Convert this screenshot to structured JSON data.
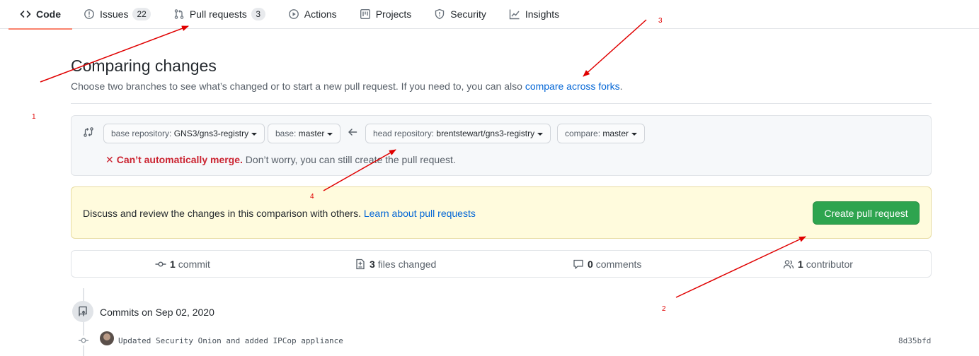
{
  "nav": {
    "tabs": [
      {
        "label": "Code",
        "icon": "code-icon",
        "selected": true
      },
      {
        "label": "Issues",
        "icon": "issue-opened-icon",
        "count": "22"
      },
      {
        "label": "Pull requests",
        "icon": "git-pull-request-icon",
        "count": "3"
      },
      {
        "label": "Actions",
        "icon": "play-icon"
      },
      {
        "label": "Projects",
        "icon": "project-icon"
      },
      {
        "label": "Security",
        "icon": "shield-icon"
      },
      {
        "label": "Insights",
        "icon": "graph-icon"
      }
    ]
  },
  "header": {
    "title": "Comparing changes",
    "subtitle": "Choose two branches to see what’s changed or to start a new pull request. If you need to, you can also ",
    "subtitle_link": "compare across forks",
    "subtitle_end": "."
  },
  "range": {
    "base_repo_label": "base repository: ",
    "base_repo_value": "GNS3/gns3-registry",
    "base_label": "base: ",
    "base_value": "master",
    "head_repo_label": "head repository: ",
    "head_repo_value": "brentstewart/gns3-registry",
    "compare_label": "compare: ",
    "compare_value": "master",
    "status_icon": "x-icon",
    "status_strong": "Can’t automatically merge.",
    "status_rest": " Don’t worry, you can still create the pull request."
  },
  "flash": {
    "message": "Discuss and review the changes in this comparison with others. ",
    "link": "Learn about pull requests",
    "button": "Create pull request"
  },
  "stats": {
    "commits_count": "1",
    "commits_label": "commit",
    "files_count": "3",
    "files_label": "files changed",
    "comments_count": "0",
    "comments_label": "comments",
    "contributors_count": "1",
    "contributors_label": "contributor"
  },
  "commits": {
    "group_title": "Commits on Sep 02, 2020",
    "items": [
      {
        "message": "Updated Security Onion and added IPCop appliance",
        "sha": "8d35bfd"
      }
    ]
  },
  "annotations": {
    "labels": [
      "1",
      "2",
      "3",
      "4"
    ],
    "color": "#e00000"
  }
}
